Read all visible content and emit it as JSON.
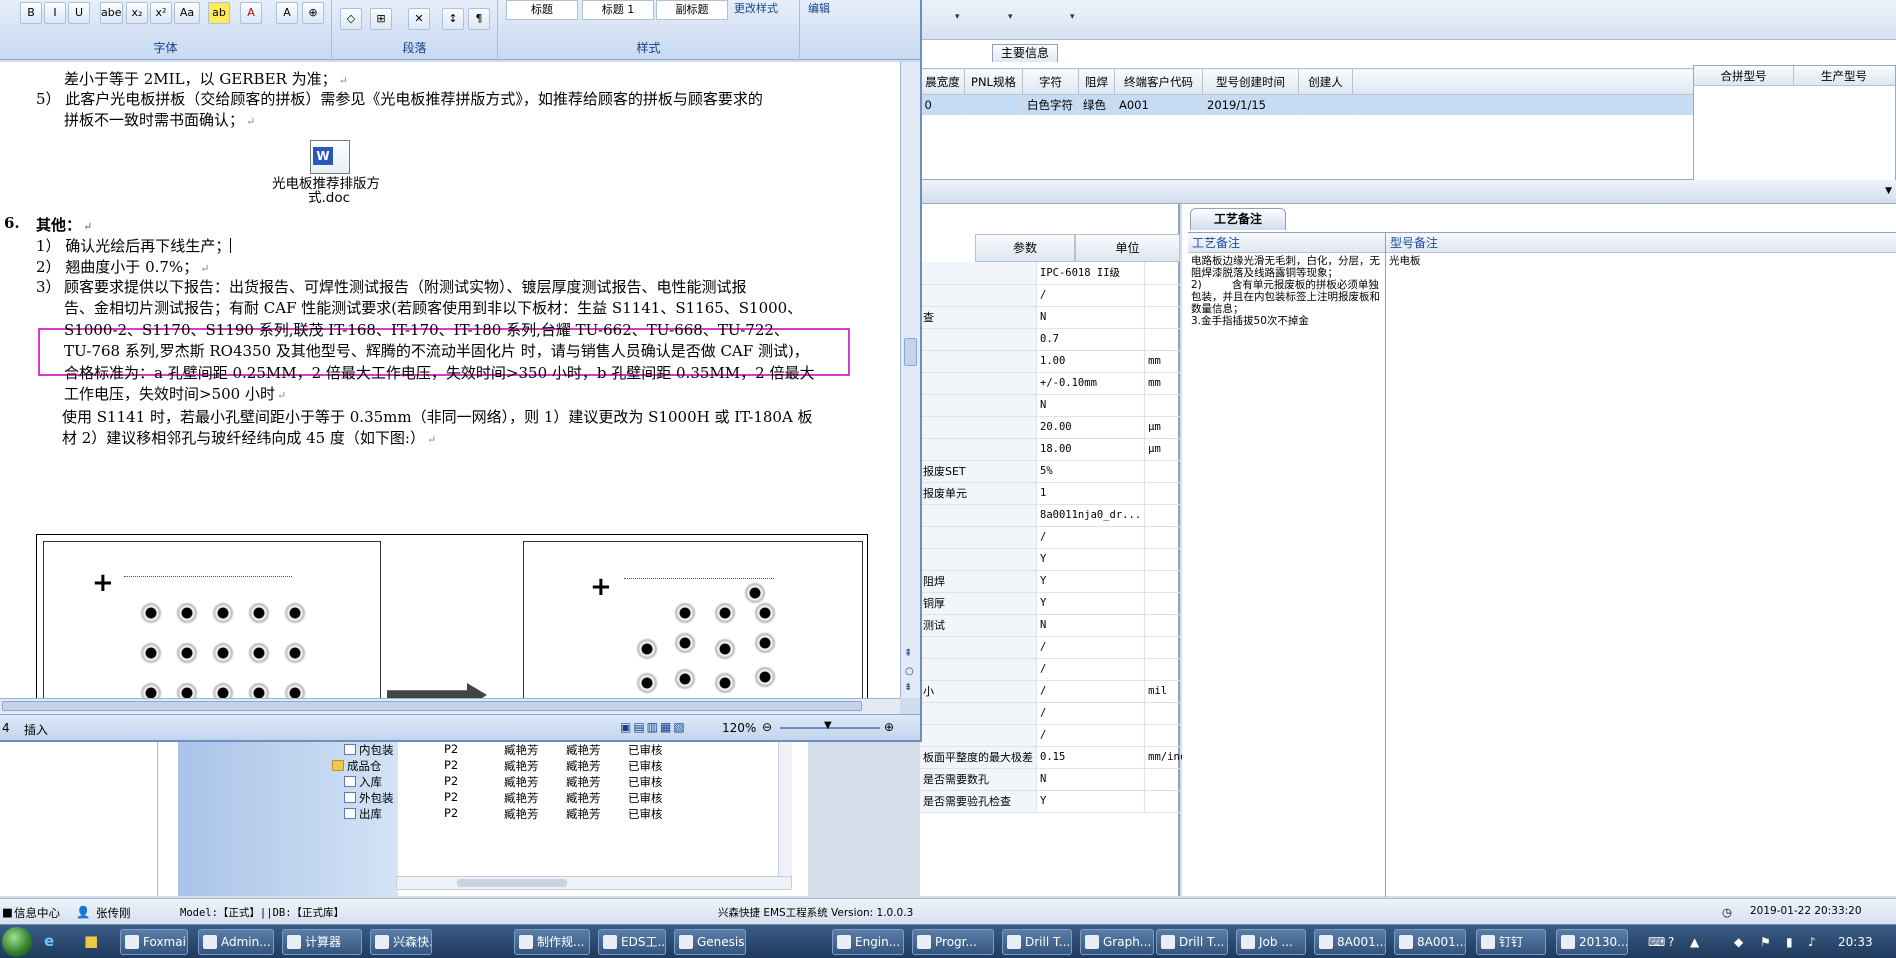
{
  "word": {
    "ribbon": {
      "font_group_label": "字体",
      "paragraph_group_label": "段落",
      "styles_group_label": "样式",
      "edit_label": "编辑",
      "change_styles_label": "更改样式",
      "style_boxes": [
        "标题",
        "标题 1",
        "副标题"
      ],
      "font_buttons": [
        "B",
        "I",
        "U",
        "abe",
        "x₂",
        "x²",
        "Aa"
      ]
    },
    "doc": {
      "line_top": "差小于等于 2MIL，以 GERBER 为准；",
      "item5_a": "5）  此客户光电板拼板（交给顾客的拼板）需参见《光电板推荐拼版方式》，如推荐给顾客的拼板与顾客要求的",
      "item5_b": "拼板不一致时需书面确认；",
      "attach_name_a": "光电板推荐排版方",
      "attach_name_b": "式.doc",
      "sec6_num": "6.",
      "sec6_title": "其他：",
      "item1": "1）  确认光绘后再下线生产；",
      "item2": "2）  翘曲度小于 0.7%；",
      "item3_num": "3）",
      "item3_a": "顾客要求提供以下报告：出货报告、可焊性测试报告（附测试实物）、镀层厚度测试报告、电性能测试报",
      "item3_b": "告、金相切片测试报告；有耐 CAF 性能测试要求(若顾客使用到非以下板材：生益 S1141、S1165、S1000、",
      "item3_c": "S1000-2、S1170、S1190 系列,联茂 IT-168、IT-170、IT-180 系列,台耀 TU-662、TU-668、TU-722、",
      "item3_d": "TU-768 系列,罗杰斯  RO4350 及其他型号、辉腾的不流动半固化片 时，请与销售人员确认是否做 CAF 测试)，",
      "item3_e": "合格标准为：a  孔壁间距 0.25MM，2 倍最大工作电压，失效时间>350 小时，b  孔壁间距 0.35MM，2 倍最大",
      "item3_f": "工作电压，失效时间>500 小时",
      "item4_a": "使用 S1141 时，若最小孔壁间距小于等于 0.35mm（非同一网络），则 1）建议更改为 S1000H 或 IT-180A 板",
      "item4_b": "材        2）建议移相邻孔与玻纤经纬向成 45 度（如下图:）",
      "plus": "+"
    },
    "status": {
      "page": "4",
      "mode": "插入",
      "zoom": "120%"
    }
  },
  "ems": {
    "main_info_tab": "主要信息",
    "grid_headers": [
      "晨宽度",
      "PNL规格",
      "字符",
      "阻焊",
      "终端客户代码",
      "型号创建时间",
      "创建人"
    ],
    "grid_row": [
      "0",
      "",
      "白色字符",
      "绿色",
      "A001",
      "2019/1/15",
      ""
    ],
    "merge_headers": [
      "合拼型号",
      "生产型号"
    ],
    "param_headers": [
      "参数",
      "单位"
    ],
    "params": [
      {
        "name": "",
        "value": "IPC-6018 II级",
        "unit": ""
      },
      {
        "name": "",
        "value": "/",
        "unit": ""
      },
      {
        "name": "查",
        "value": "N",
        "unit": ""
      },
      {
        "name": "",
        "value": "0.7",
        "unit": ""
      },
      {
        "name": "",
        "value": "1.00",
        "unit": "mm"
      },
      {
        "name": "",
        "value": "+/-0.10mm",
        "unit": "mm"
      },
      {
        "name": "",
        "value": "N",
        "unit": ""
      },
      {
        "name": "",
        "value": "20.00",
        "unit": "μm"
      },
      {
        "name": "",
        "value": "18.00",
        "unit": "μm"
      },
      {
        "name": "报废SET",
        "value": "5%",
        "unit": ""
      },
      {
        "name": "报废单元",
        "value": "1",
        "unit": ""
      },
      {
        "name": "",
        "value": "8a0011nja0_dr...",
        "unit": ""
      },
      {
        "name": "",
        "value": "/",
        "unit": ""
      },
      {
        "name": "",
        "value": "Y",
        "unit": ""
      },
      {
        "name": "阻焊",
        "value": "Y",
        "unit": ""
      },
      {
        "name": "铜厚",
        "value": "Y",
        "unit": ""
      },
      {
        "name": "测试",
        "value": "N",
        "unit": ""
      },
      {
        "name": "",
        "value": "/",
        "unit": ""
      },
      {
        "name": "",
        "value": "/",
        "unit": ""
      },
      {
        "name": "小",
        "value": "/",
        "unit": "mil"
      },
      {
        "name": "",
        "value": "/",
        "unit": ""
      },
      {
        "name": "",
        "value": "/",
        "unit": ""
      },
      {
        "name": "板面平整度的最大极差",
        "value": "0.15",
        "unit": "mm/inch"
      },
      {
        "name": "是否需要数孔",
        "value": "N",
        "unit": ""
      },
      {
        "name": "是否需要验孔检查",
        "value": "Y",
        "unit": ""
      }
    ],
    "remark_tab": "工艺备注",
    "remark_col_title": "工艺备注",
    "remark_text": "电路板边缘光滑无毛刺，白化，分层，无阻焊漆脱落及线路露铜等现象；\n2)         含有单元报废板的拼板必须单独包装，并且在内包装标签上注明报废板和数量信息；\n3.金手指插拔50次不掉金",
    "model_remark_title": "型号备注",
    "model_remark_text": "光电板",
    "tree_rows": [
      {
        "label": "内包装",
        "c1": "P2",
        "c2": "臧艳芳",
        "c3": "臧艳芳",
        "c4": "已审核",
        "kind": "doc"
      },
      {
        "label": "成品仓",
        "c1": "P2",
        "c2": "臧艳芳",
        "c3": "臧艳芳",
        "c4": "已审核",
        "kind": "folder"
      },
      {
        "label": "入库",
        "c1": "P2",
        "c2": "臧艳芳",
        "c3": "臧艳芳",
        "c4": "已审核",
        "kind": "doc"
      },
      {
        "label": "外包装",
        "c1": "P2",
        "c2": "臧艳芳",
        "c3": "臧艳芳",
        "c4": "已审核",
        "kind": "doc"
      },
      {
        "label": "出库",
        "c1": "P2",
        "c2": "臧艳芳",
        "c3": "臧艳芳",
        "c4": "已审核",
        "kind": "doc"
      }
    ],
    "status": {
      "info_center": "信息中心",
      "user": "张传刚",
      "model_db": "Model:【正式】||DB:【正式库】",
      "system": "兴森快捷  EMS工程系统  Version: 1.0.0.3",
      "datetime": "2019-01-22 20:33:20"
    }
  },
  "taskbar": {
    "items": [
      "Foxmail",
      "Admin...",
      "计算器",
      "兴森快...",
      "制作规...",
      "EDS工...",
      "Genesis",
      "Engin...",
      "Progr...",
      "Drill T...",
      "Graph...",
      "Drill T...",
      "Job ...",
      "8A001...",
      "8A001...",
      "钉钉",
      "20130..."
    ],
    "clock": "20:33"
  }
}
